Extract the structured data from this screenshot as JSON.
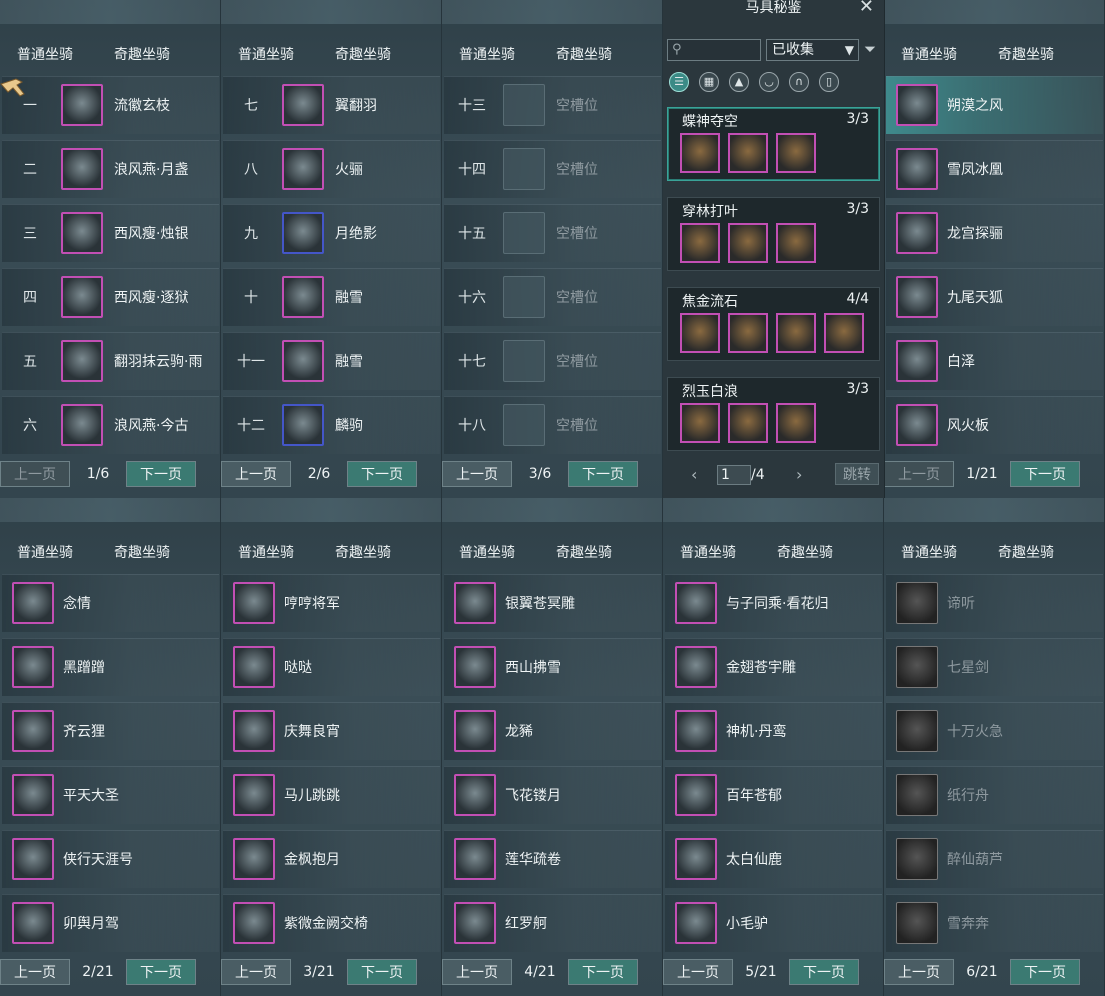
{
  "tabs": {
    "normal": "普通坐骑",
    "fun": "奇趣坐骑"
  },
  "pager": {
    "prev": "上一页",
    "next": "下一页"
  },
  "panels": [
    {
      "page": "1/6",
      "prev_disabled": true,
      "rows": [
        {
          "num": "一",
          "name": "流徽玄枝",
          "icon": "black-horse-icon"
        },
        {
          "num": "二",
          "name": "浪风燕·月盏",
          "icon": "white-horse-icon"
        },
        {
          "num": "三",
          "name": "西风瘦·烛银",
          "icon": "chestnut-horse-icon"
        },
        {
          "num": "四",
          "name": "西风瘦·逐狱",
          "icon": "black-horse-icon"
        },
        {
          "num": "五",
          "name": "翻羽抹云驹·雨",
          "icon": "dark-horse-icon"
        },
        {
          "num": "六",
          "name": "浪风燕·今古",
          "icon": "white-horse-icon"
        }
      ]
    },
    {
      "page": "2/6",
      "prev_disabled": false,
      "rows": [
        {
          "num": "七",
          "name": "翼翻羽",
          "icon": "black-horse-icon"
        },
        {
          "num": "八",
          "name": "火骊",
          "icon": "brown-horse-icon"
        },
        {
          "num": "九",
          "name": "月绝影",
          "icon": "white-horse-icon",
          "blue": true
        },
        {
          "num": "十",
          "name": "融雪",
          "icon": "white-horse-icon"
        },
        {
          "num": "十一",
          "name": "融雪",
          "icon": "white-horse-icon"
        },
        {
          "num": "十二",
          "name": "麟驹",
          "icon": "black-horse-icon",
          "blue": true
        }
      ]
    },
    {
      "page": "3/6",
      "prev_disabled": false,
      "rows": [
        {
          "num": "十三",
          "name": "空槽位",
          "empty": true
        },
        {
          "num": "十四",
          "name": "空槽位",
          "empty": true
        },
        {
          "num": "十五",
          "name": "空槽位",
          "empty": true
        },
        {
          "num": "十六",
          "name": "空槽位",
          "empty": true
        },
        {
          "num": "十七",
          "name": "空槽位",
          "empty": true
        },
        {
          "num": "十八",
          "name": "空槽位",
          "empty": true
        }
      ]
    },
    {
      "page": "1/21",
      "prev_disabled": true,
      "rows": [
        {
          "name": "朔漠之风",
          "icon": "cart-icon",
          "selected": true
        },
        {
          "name": "雪凤冰凰",
          "icon": "phoenix-icon"
        },
        {
          "name": "龙宫探骊",
          "icon": "dragon-icon"
        },
        {
          "name": "九尾天狐",
          "icon": "fox-icon"
        },
        {
          "name": "白泽",
          "icon": "beast-icon"
        },
        {
          "name": "风火板",
          "icon": "skateboard-icon"
        }
      ]
    },
    {
      "page": "2/21",
      "prev_disabled": false,
      "rows": [
        {
          "name": "念情",
          "icon": "scroll-icon"
        },
        {
          "name": "黑蹭蹭",
          "icon": "bird-icon"
        },
        {
          "name": "齐云狸",
          "icon": "cat-icon"
        },
        {
          "name": "平天大圣",
          "icon": "ape-icon"
        },
        {
          "name": "侠行天涯号",
          "icon": "boat-icon"
        },
        {
          "name": "卯舆月驾",
          "icon": "carriage-icon"
        }
      ]
    },
    {
      "page": "3/21",
      "prev_disabled": false,
      "rows": [
        {
          "name": "哼哼将军",
          "icon": "pig-icon"
        },
        {
          "name": "哒哒",
          "icon": "deer-icon"
        },
        {
          "name": "庆舞良宵",
          "icon": "lion-dance-icon"
        },
        {
          "name": "马儿跳跳",
          "icon": "hobby-horse-icon"
        },
        {
          "name": "金枫抱月",
          "icon": "golden-ball-icon"
        },
        {
          "name": "紫微金阙交椅",
          "icon": "chair-icon"
        }
      ]
    },
    {
      "page": "4/21",
      "prev_disabled": false,
      "rows": [
        {
          "name": "银翼苍冥雕",
          "icon": "eagle-icon"
        },
        {
          "name": "西山拂雪",
          "icon": "white-deer-icon"
        },
        {
          "name": "龙豨",
          "icon": "boar-icon"
        },
        {
          "name": "飞花镂月",
          "icon": "golden-wheel-icon"
        },
        {
          "name": "莲华疏卷",
          "icon": "white-horse-icon"
        },
        {
          "name": "红罗舸",
          "icon": "red-boat-icon"
        }
      ]
    },
    {
      "page": "5/21",
      "prev_disabled": false,
      "rows": [
        {
          "name": "与子同乘·看花归",
          "icon": "umbrella-rider-icon"
        },
        {
          "name": "金翅苍宇雕",
          "icon": "eagle-icon"
        },
        {
          "name": "神机·丹鸾",
          "icon": "mech-bird-icon"
        },
        {
          "name": "百年苍郁",
          "icon": "tree-icon"
        },
        {
          "name": "太白仙鹿",
          "icon": "antler-icon"
        },
        {
          "name": "小毛驴",
          "icon": "donkey-icon"
        }
      ]
    },
    {
      "page": "6/21",
      "prev_disabled": false,
      "dim": true,
      "rows": [
        {
          "name": "谛听",
          "icon": "beast-icon"
        },
        {
          "name": "七星剑",
          "icon": "sword-icon"
        },
        {
          "name": "十万火急",
          "icon": "fireball-icon"
        },
        {
          "name": "纸行舟",
          "icon": "paper-boat-icon"
        },
        {
          "name": "醉仙葫芦",
          "icon": "gourd-icon"
        },
        {
          "name": "雪奔奔",
          "icon": "snow-beast-icon"
        }
      ]
    }
  ],
  "modal": {
    "title": "马具秘鉴",
    "search_value": "",
    "filter_value": "已收集",
    "categories": [
      "list-view-icon",
      "grid-view-icon",
      "saddle-icon",
      "bird-wing-icon",
      "horseshoe-icon",
      "armor-icon"
    ],
    "sets": [
      {
        "name": "蝶神夺空",
        "count": "3/3",
        "icons": 3,
        "active": true
      },
      {
        "name": "穿林打叶",
        "count": "3/3",
        "icons": 3
      },
      {
        "name": "焦金流石",
        "count": "4/4",
        "icons": 4
      },
      {
        "name": "烈玉白浪",
        "count": "3/3",
        "icons": 3
      }
    ],
    "page_input": "1",
    "page_total": "/4",
    "jump": "跳转"
  },
  "colors": {
    "accent_teal": "#3b7a72",
    "icon_border_purple": "#c24fb4",
    "icon_border_blue": "#4456c8"
  }
}
